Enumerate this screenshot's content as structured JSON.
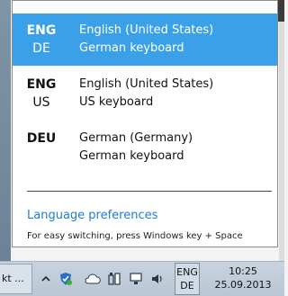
{
  "flyout": {
    "languages": [
      {
        "code": "ENG",
        "sub_code": "DE",
        "name": "English (United States)",
        "keyboard": "German keyboard",
        "selected": true
      },
      {
        "code": "ENG",
        "sub_code": "US",
        "name": "English (United States)",
        "keyboard": "US keyboard",
        "selected": false
      },
      {
        "code": "DEU",
        "sub_code": "",
        "name": "German (Germany)",
        "keyboard": "German keyboard",
        "selected": false
      }
    ],
    "preferences_link": "Language preferences",
    "hint": "For easy switching, press Windows key + Space"
  },
  "taskbar": {
    "task_button_label": "kt ...",
    "tray_icons": [
      "chevron-up-icon",
      "shield-icon",
      "cloud-icon",
      "power-icon",
      "network-icon",
      "volume-icon"
    ],
    "ime": {
      "line1": "ENG",
      "line2": "DE"
    },
    "clock": {
      "time": "10:25",
      "date": "25.09.2013"
    }
  },
  "colors": {
    "selected_bg": "#3aa0e8",
    "link": "#1e7bd4",
    "taskbar": "#c2cdd8"
  }
}
